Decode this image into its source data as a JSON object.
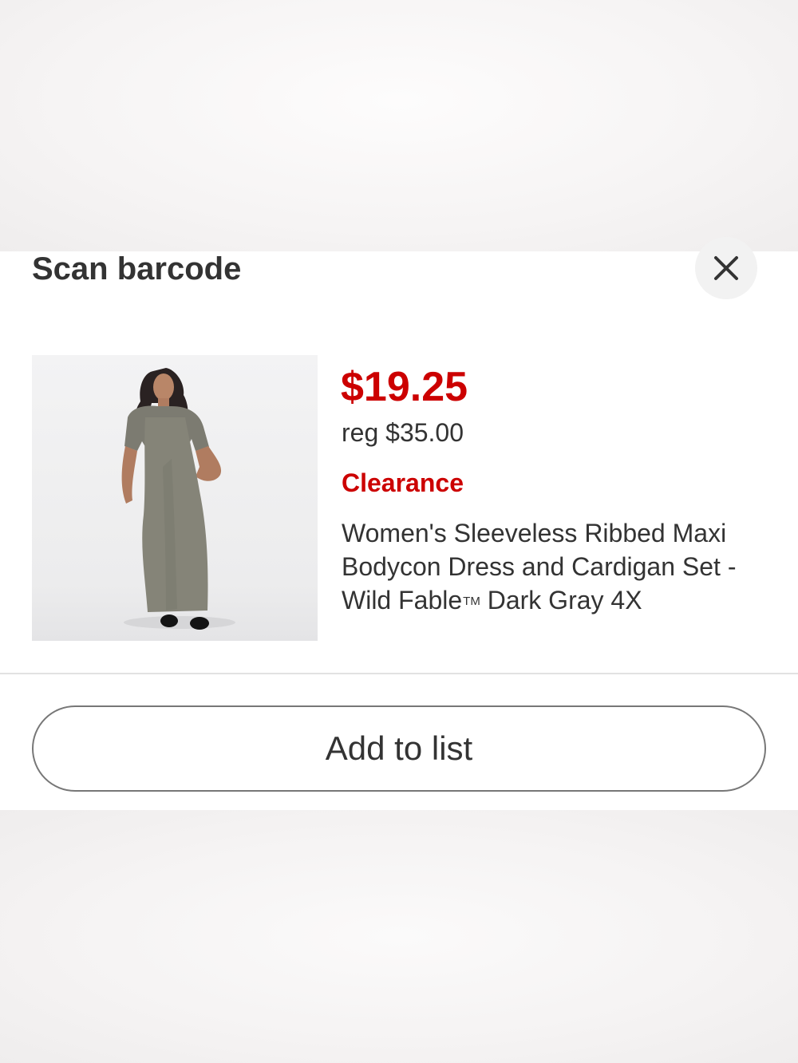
{
  "sheet": {
    "title": "Scan barcode",
    "close_icon": "close-icon"
  },
  "product": {
    "image_icon": "product-photo",
    "sale_price": "$19.25",
    "reg_price": "reg $35.00",
    "badge": "Clearance",
    "title_before_tm": "Women's Sleeveless Ribbed Maxi Bodycon Dress and Cardigan Set - Wild Fable",
    "tm": "TM",
    "title_after_tm": " Dark Gray 4X"
  },
  "actions": {
    "add_to_list_label": "Add to list"
  },
  "colors": {
    "price_red": "#cc0000",
    "text": "#333333",
    "border": "#777777"
  }
}
